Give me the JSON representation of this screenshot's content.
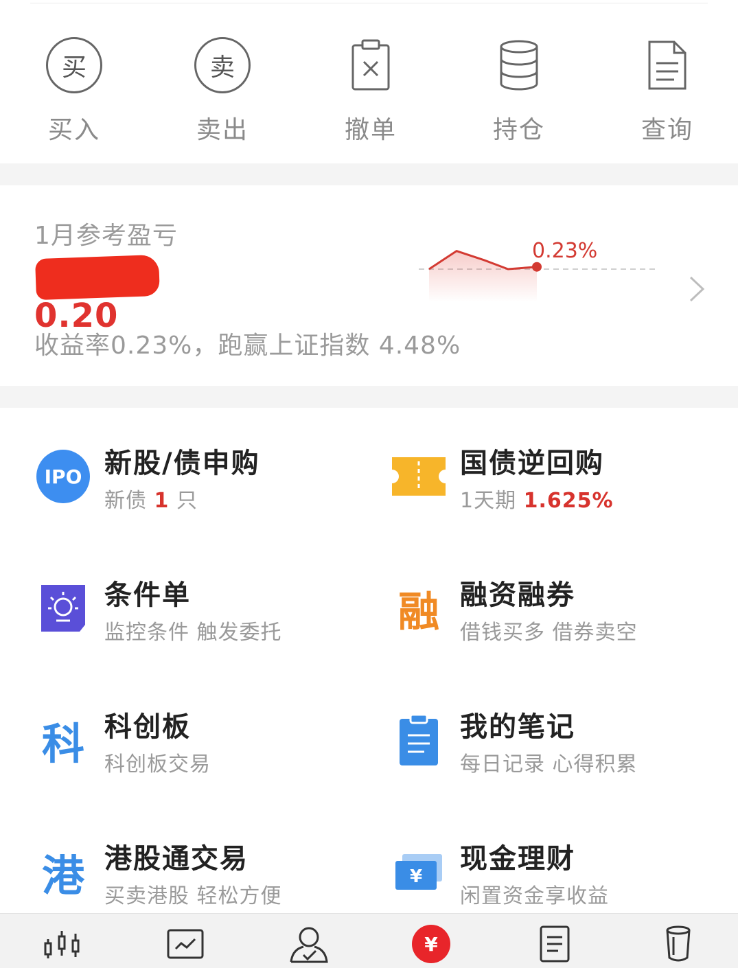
{
  "quick_actions": [
    {
      "label": "买入",
      "icon_glyph": "买",
      "icon": "buy-icon"
    },
    {
      "label": "卖出",
      "icon_glyph": "卖",
      "icon": "sell-icon"
    },
    {
      "label": "撤单",
      "icon": "cancel-order-icon"
    },
    {
      "label": "持仓",
      "icon": "holdings-icon"
    },
    {
      "label": "查询",
      "icon": "query-icon"
    }
  ],
  "pnl": {
    "title": "1月参考盈亏",
    "amount_visible": "0.20",
    "rate_text": "收益率0.23%，跑赢上证指数 4.48%",
    "spark_label": "0.23%",
    "spark_values": [
      0.0,
      0.24,
      0.12,
      0.0,
      0.03
    ],
    "color_up": "#d33a32"
  },
  "features": [
    {
      "title": "新股/债申购",
      "sub_prefix": "新债 ",
      "sub_highlight": "1",
      "sub_suffix": " 只",
      "icon": "ipo-icon",
      "icon_text": "IPO",
      "icon_color": "#3d8ef0"
    },
    {
      "title": "国债逆回购",
      "sub_prefix": "1天期 ",
      "sub_highlight": "1.625%",
      "sub_suffix": "",
      "icon": "ticket-icon",
      "icon_color": "#f7b52a"
    },
    {
      "title": "条件单",
      "sub_prefix": "监控条件 触发委托",
      "icon": "condition-order-icon",
      "icon_color": "#5a4fd8"
    },
    {
      "title": "融资融券",
      "sub_prefix": "借钱买多 借券卖空",
      "icon": "margin-trading-icon",
      "icon_text": "融",
      "icon_color": "#f08a24"
    },
    {
      "title": "科创板",
      "sub_prefix": "科创板交易",
      "icon": "star-market-icon",
      "icon_text": "科",
      "icon_color": "#3a8de6"
    },
    {
      "title": "我的笔记",
      "sub_prefix": "每日记录 心得积累",
      "icon": "notes-icon",
      "icon_color": "#3a8de6"
    },
    {
      "title": "港股通交易",
      "sub_prefix": "买卖港股 轻松方便",
      "icon": "hk-connect-icon",
      "icon_text": "港",
      "icon_color": "#3a8de6"
    },
    {
      "title": "现金理财",
      "sub_prefix": "闲置资金享收益",
      "icon": "cash-management-icon",
      "icon_glyph": "¥",
      "icon_color": "#3a8de6"
    }
  ],
  "tabbar": {
    "tabs": [
      "market-tab-icon",
      "chart-tab-icon",
      "account-tab-icon",
      "trade-tab-icon",
      "news-tab-icon",
      "more-tab-icon"
    ],
    "active_glyph": "¥",
    "active_color": "#e8252a"
  }
}
